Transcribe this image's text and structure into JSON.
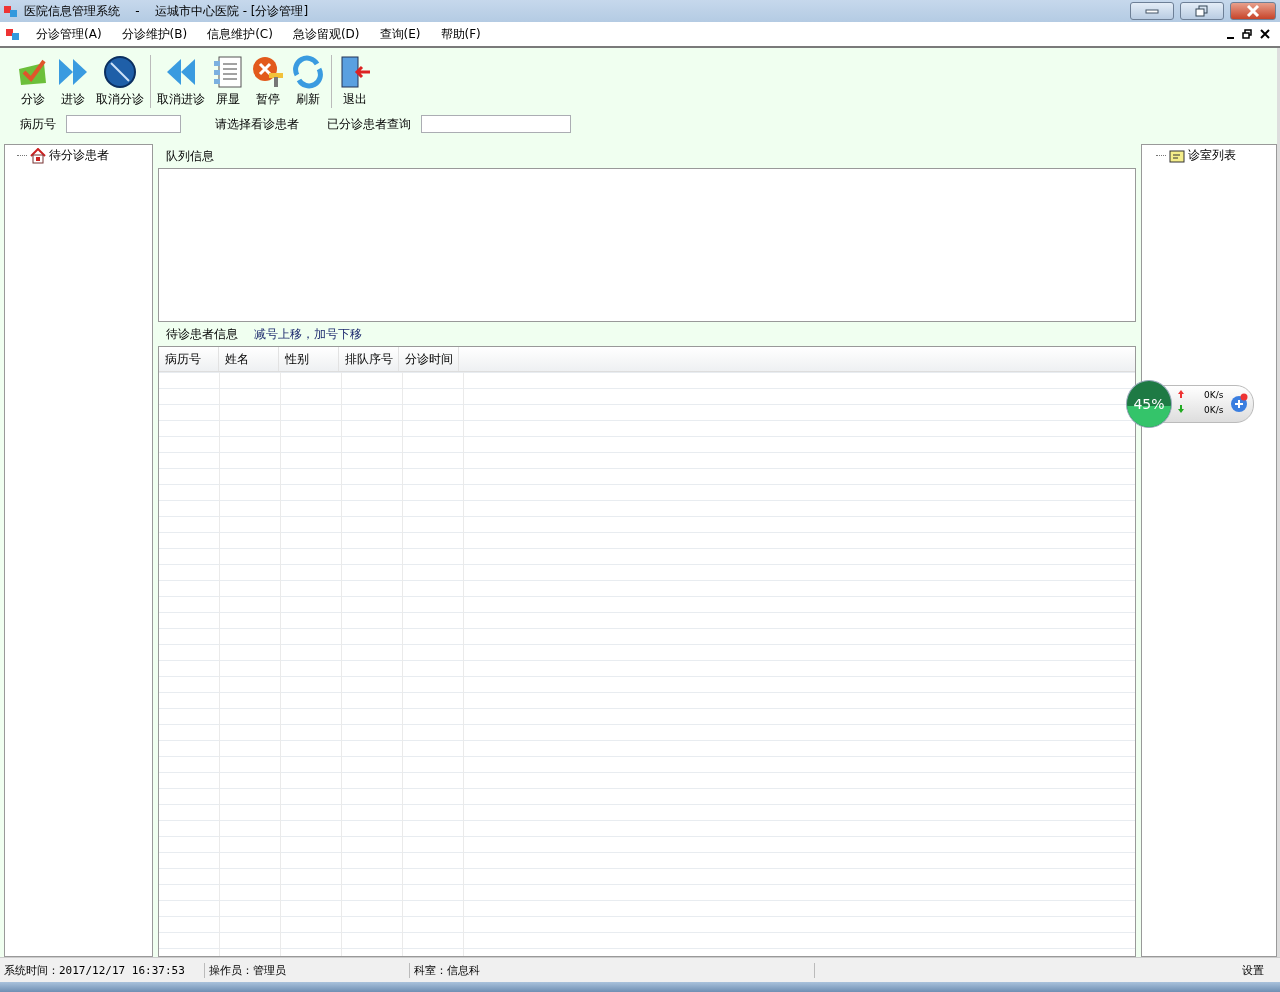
{
  "window": {
    "title": "医院信息管理系统    -    运城市中心医院 - [分诊管理]"
  },
  "menu": [
    "分诊管理(A)",
    "分诊维护(B)",
    "信息维护(C)",
    "急诊留观(D)",
    "查询(E)",
    "帮助(F)"
  ],
  "toolbar": [
    [
      "分诊",
      "进诊",
      "取消分诊"
    ],
    [
      "取消进诊",
      "屏显",
      "暂停",
      "刷新"
    ],
    [
      "退出"
    ]
  ],
  "search": {
    "record_label": "病历号",
    "select_label": "请选择看诊患者",
    "query_label": "已分诊患者查询"
  },
  "left_tree": {
    "label": "待分诊患者"
  },
  "queue": {
    "title": "队列信息"
  },
  "waiting": {
    "title": "待诊患者信息",
    "hint": "减号上移，加号下移",
    "columns": [
      "病历号",
      "姓名",
      "性别",
      "排队序号",
      "分诊时间"
    ]
  },
  "right_tree": {
    "label": "诊室列表"
  },
  "monitor": {
    "reading": "45%",
    "level": 0.45,
    "up": "0K/s",
    "down": "0K/s"
  },
  "status_bar": [
    "系统时间：2017/12/17 16:37:53",
    "操作员：管理员",
    "科室：信息科",
    "设置"
  ]
}
